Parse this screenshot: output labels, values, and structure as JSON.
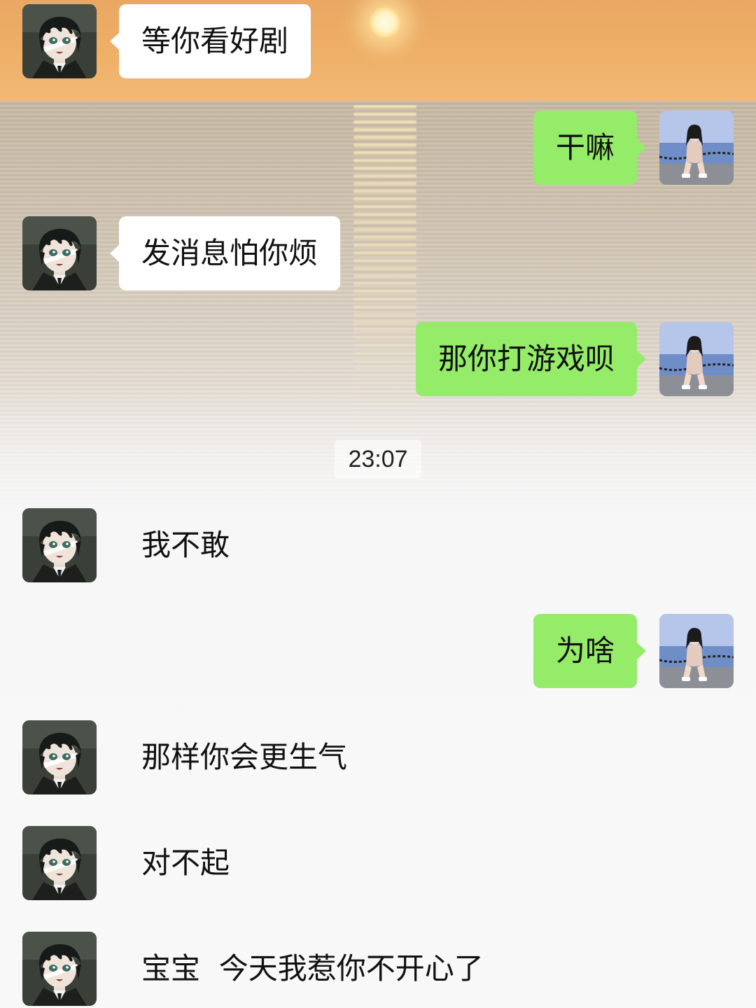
{
  "colors": {
    "outgoing_bubble": "#95ec69",
    "incoming_bubble": "#ffffff"
  },
  "avatars": {
    "contact": "anime-boy-avatar",
    "self": "girl-by-sea-photo-avatar"
  },
  "messages": [
    {
      "side": "left",
      "text": "等你看好剧"
    },
    {
      "side": "right",
      "text": "干嘛"
    },
    {
      "side": "left",
      "text": "发消息怕你烦"
    },
    {
      "side": "right",
      "text": "那你打游戏呗"
    },
    {
      "side": "left",
      "text": "我不敢"
    },
    {
      "side": "right",
      "text": "为啥"
    },
    {
      "side": "left",
      "text": "那样你会更生气"
    },
    {
      "side": "left",
      "text": "对不起"
    },
    {
      "side": "left",
      "text": "宝宝  今天我惹你不开心了"
    }
  ],
  "timestamp": "23:07"
}
